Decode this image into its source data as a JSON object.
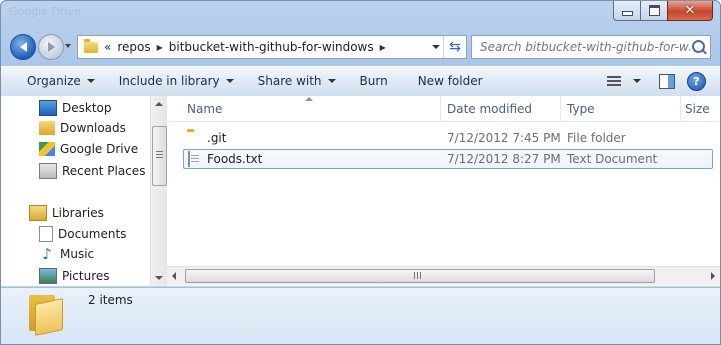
{
  "window": {
    "ghost_title": "Google Drive",
    "controls": {
      "minimize": "–",
      "maximize": "□",
      "close": "✕"
    }
  },
  "nav": {
    "back_icon": "back-arrow-icon",
    "forward_icon": "forward-arrow-icon",
    "address": {
      "overflow": "«",
      "crumbs": [
        "repos",
        "bitbucket-with-github-for-windows"
      ]
    },
    "refresh_icon": "refresh-icon",
    "search": {
      "placeholder": "Search bitbucket-with-github-for-win..."
    }
  },
  "toolbar": {
    "organize": "Organize",
    "include_in_library": "Include in library",
    "share_with": "Share with",
    "burn": "Burn",
    "new_folder": "New folder"
  },
  "sidebar": {
    "items": [
      {
        "label": "Desktop",
        "icon": "desktop-icon"
      },
      {
        "label": "Downloads",
        "icon": "downloads-icon"
      },
      {
        "label": "Google Drive",
        "icon": "google-drive-icon"
      },
      {
        "label": "Recent Places",
        "icon": "recent-places-icon"
      },
      {
        "label": "Libraries",
        "icon": "libraries-icon"
      },
      {
        "label": "Documents",
        "icon": "documents-icon"
      },
      {
        "label": "Music",
        "icon": "music-icon"
      },
      {
        "label": "Pictures",
        "icon": "pictures-icon"
      }
    ]
  },
  "files": {
    "columns": [
      "Name",
      "Date modified",
      "Type",
      "Size"
    ],
    "rows": [
      {
        "name": ".git",
        "date": "7/12/2012 7:45 PM",
        "type": "File folder",
        "icon": "folder-icon"
      },
      {
        "name": "Foods.txt",
        "date": "7/12/2012 8:27 PM",
        "type": "Text Document",
        "icon": "text-file-icon"
      }
    ]
  },
  "details": {
    "count": "2 items"
  },
  "colors": {
    "window_frame": "#a9c5e6",
    "selection_border": "#7da2ce",
    "close_button": "#c7462e"
  }
}
